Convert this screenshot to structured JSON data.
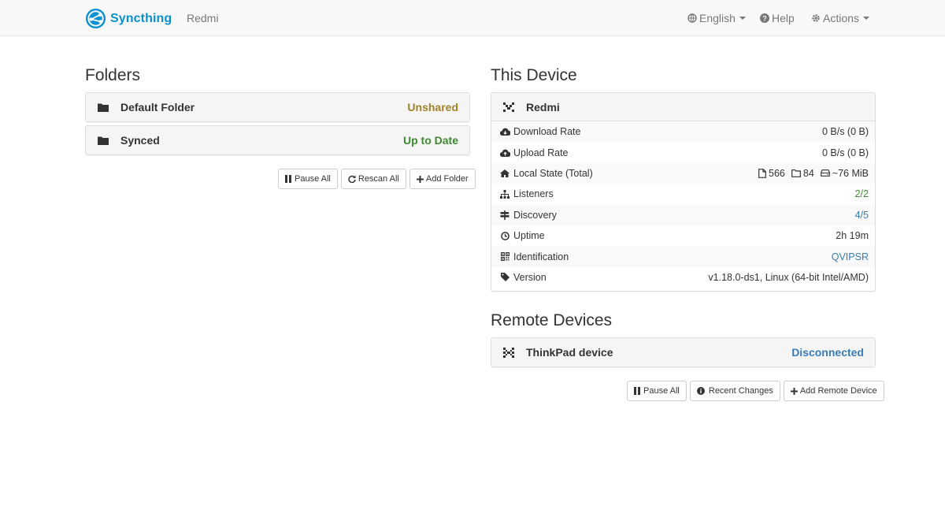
{
  "navbar": {
    "brand": "Syncthing",
    "device": "Redmi",
    "language": "English",
    "help": "Help",
    "actions": "Actions"
  },
  "folders": {
    "title": "Folders",
    "items": [
      {
        "name": "Default Folder",
        "status": "Unshared"
      },
      {
        "name": "Synced",
        "status": "Up to Date"
      }
    ],
    "buttons": {
      "pause_all": "Pause All",
      "rescan_all": "Rescan All",
      "add_folder": "Add Folder"
    }
  },
  "this_device": {
    "title": "This Device",
    "name": "Redmi",
    "rows": {
      "download_rate": {
        "label": "Download Rate",
        "value": "0 B/s (0 B)"
      },
      "upload_rate": {
        "label": "Upload Rate",
        "value": "0 B/s (0 B)"
      },
      "local_state": {
        "label": "Local State (Total)",
        "files": "566",
        "dirs": "84",
        "size": "~76 MiB"
      },
      "listeners": {
        "label": "Listeners",
        "value": "2/2"
      },
      "discovery": {
        "label": "Discovery",
        "value": "4/5"
      },
      "uptime": {
        "label": "Uptime",
        "value": "2h 19m"
      },
      "identification": {
        "label": "Identification",
        "value": "QVIPSR"
      },
      "version": {
        "label": "Version",
        "value": "v1.18.0-ds1, Linux (64-bit Intel/AMD)"
      }
    }
  },
  "remote_devices": {
    "title": "Remote Devices",
    "items": [
      {
        "name": "ThinkPad device",
        "status": "Disconnected"
      }
    ],
    "buttons": {
      "pause_all": "Pause All",
      "recent_changes": "Recent Changes",
      "add_remote_device": "Add Remote Device"
    }
  },
  "colors": {
    "brand": "#0891d1",
    "unshared": "#a0812a",
    "up_to_date": "#3c8a2e",
    "link": "#3a7cb8"
  }
}
